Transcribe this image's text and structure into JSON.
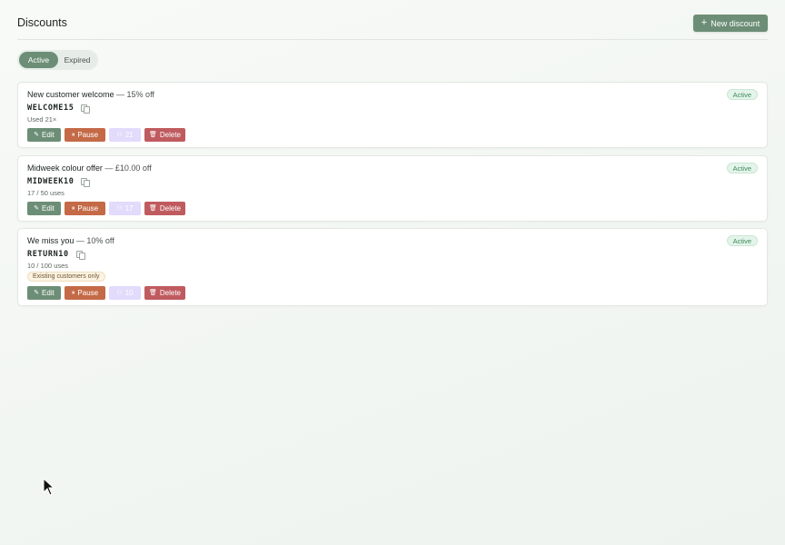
{
  "header": {
    "title": "Discounts",
    "new_button_label": "New discount",
    "new_button_icon": "plus-icon"
  },
  "tabs": [
    {
      "label": "Active",
      "selected": true
    },
    {
      "label": "Expired",
      "selected": false
    }
  ],
  "colors": {
    "accent": "#6d8e76",
    "pause": "#c46a47",
    "delete": "#bf5b5f",
    "uses": "#e2dbfb",
    "status_bg": "#e4f4ea",
    "status_text": "#3d8a5a"
  },
  "discounts": [
    {
      "name": "New customer welcome",
      "amount": "— 15% off",
      "code": "WELCOME15",
      "usage": "Used 21×",
      "status": "Active",
      "actions": {
        "edit": "Edit",
        "pause": "Pause",
        "uses": "21",
        "delete": "Delete"
      }
    },
    {
      "name": "Midweek colour offer",
      "amount": "— £10.00 off",
      "code": "MIDWEEK10",
      "usage": "17 / 50 uses",
      "status": "Active",
      "actions": {
        "edit": "Edit",
        "pause": "Pause",
        "uses": "17",
        "delete": "Delete"
      }
    },
    {
      "name": "We miss you",
      "amount": "— 10% off",
      "code": "RETURN10",
      "usage": "10 / 100 uses",
      "tag": "Existing customers only",
      "status": "Active",
      "actions": {
        "edit": "Edit",
        "pause": "Pause",
        "uses": "10",
        "delete": "Delete"
      }
    }
  ]
}
